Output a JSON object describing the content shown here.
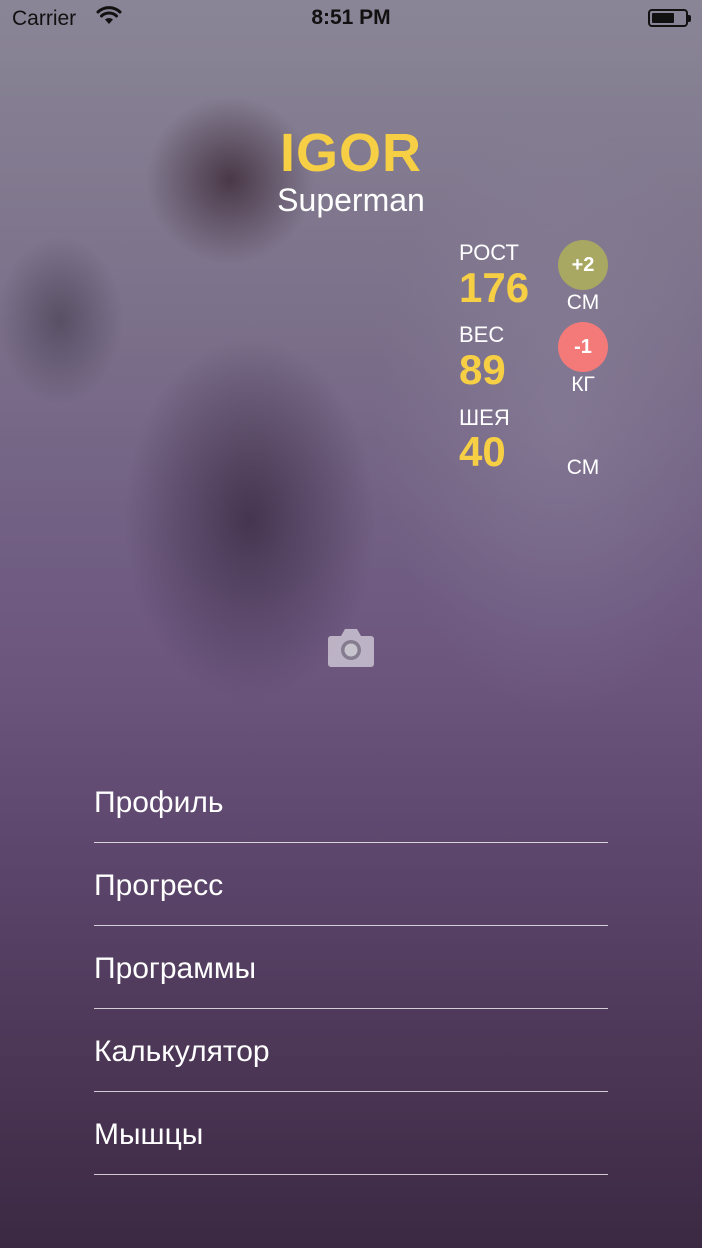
{
  "status_bar": {
    "carrier": "Carrier",
    "time": "8:51 PM"
  },
  "profile": {
    "name": "IGOR",
    "subtitle": "Superman"
  },
  "stats": {
    "height": {
      "label": "РОСТ",
      "value": "176",
      "unit": "СМ",
      "change": "+2",
      "change_color": "#a9a862"
    },
    "weight": {
      "label": "ВЕС",
      "value": "89",
      "unit": "КГ",
      "change": "-1",
      "change_color": "#f47a7a"
    },
    "neck": {
      "label": "ШЕЯ",
      "value": "40",
      "unit": "СМ"
    }
  },
  "colors": {
    "accent": "#f7cf45",
    "text": "#ffffff"
  },
  "icons": {
    "photo": "camera-icon"
  },
  "menu": {
    "items": [
      {
        "label": "Профиль"
      },
      {
        "label": "Прогресс"
      },
      {
        "label": "Программы"
      },
      {
        "label": "Калькулятор"
      },
      {
        "label": "Мышцы"
      }
    ]
  }
}
